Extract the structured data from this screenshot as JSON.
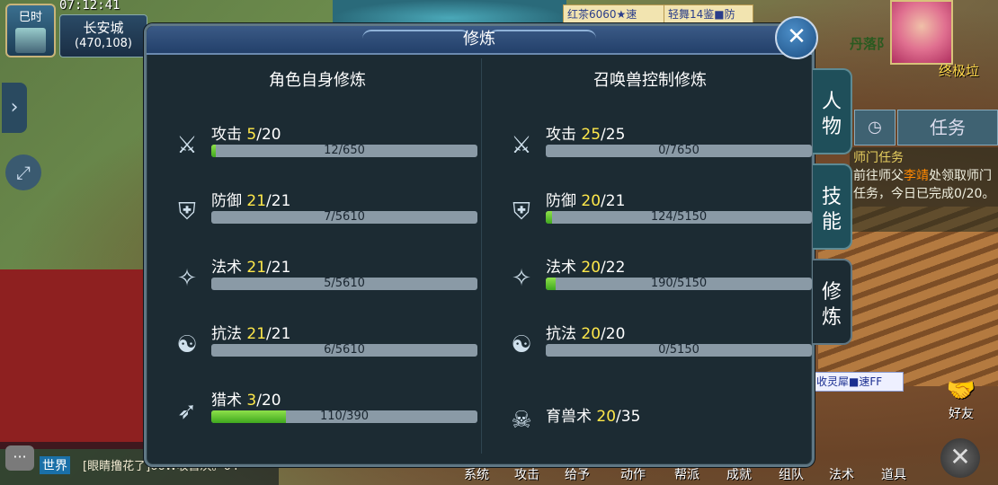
{
  "hud": {
    "period": "巳时",
    "time": "07:12:41",
    "city": "长安城",
    "coords": "(470,108)",
    "banner1": "红茶6060★速",
    "banner2": "轻舞14鉴■防",
    "quest_top": "丹落阝",
    "quest_level": "终极垃",
    "quest_tab": "任务",
    "quest_title": "师门任务",
    "quest_body_pre": "前往师父",
    "quest_body_npc": "李靖",
    "quest_body_post": "处领取师门任务，今日已完成0/20。",
    "chip_right": "收灵犀■速FF",
    "friend": "好友",
    "chat_channel": "世界",
    "chat_msg": "[眼睛撸花了]66W收兽决。64",
    "menu": [
      "系统",
      "攻击",
      "给予",
      "动作",
      "帮派",
      "成就",
      "组队",
      "法术",
      "道具"
    ]
  },
  "modal": {
    "title": "修炼",
    "left_title": "角色自身修炼",
    "right_title": "召唤兽控制修炼",
    "tabs": [
      "人物",
      "技能",
      "修炼"
    ],
    "left_rows": [
      {
        "icon": "attack-icon",
        "name": "攻击",
        "level": "5",
        "max": "/20",
        "progress": "12/650",
        "fill": 0.018
      },
      {
        "icon": "defense-icon",
        "name": "防御",
        "level": "21",
        "max": "/21",
        "progress": "7/5610",
        "fill": 0.001
      },
      {
        "icon": "magic-icon",
        "name": "法术",
        "level": "21",
        "max": "/21",
        "progress": "5/5610",
        "fill": 0.001
      },
      {
        "icon": "resist-icon",
        "name": "抗法",
        "level": "21",
        "max": "/21",
        "progress": "6/5610",
        "fill": 0.001
      },
      {
        "icon": "hunt-icon",
        "name": "猎术",
        "level": "3",
        "max": "/20",
        "progress": "110/390",
        "fill": 0.282
      }
    ],
    "right_rows": [
      {
        "icon": "attack-icon",
        "name": "攻击",
        "level": "25",
        "max": "/25",
        "progress": "0/7650",
        "fill": 0
      },
      {
        "icon": "defense-icon",
        "name": "防御",
        "level": "20",
        "max": "/21",
        "progress": "124/5150",
        "fill": 0.024
      },
      {
        "icon": "magic-icon",
        "name": "法术",
        "level": "20",
        "max": "/22",
        "progress": "190/5150",
        "fill": 0.037
      },
      {
        "icon": "resist-icon",
        "name": "抗法",
        "level": "20",
        "max": "/20",
        "progress": "0/5150",
        "fill": 0
      },
      {
        "icon": "beast-icon",
        "name": "育兽术",
        "level": "20",
        "max": "/35"
      }
    ]
  }
}
